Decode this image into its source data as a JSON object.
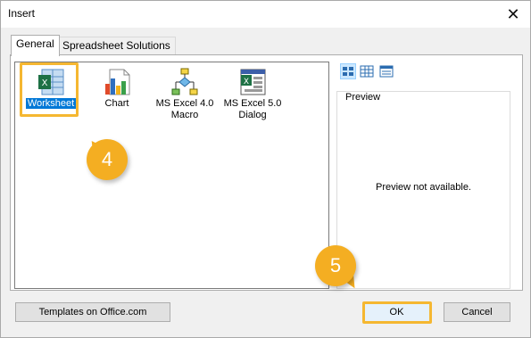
{
  "window": {
    "title": "Insert"
  },
  "tabs": [
    {
      "label": "General",
      "active": true
    },
    {
      "label": "Spreadsheet Solutions",
      "active": false
    }
  ],
  "items": [
    {
      "label": "Worksheet",
      "icon": "excel-worksheet-icon",
      "selected": true
    },
    {
      "label": "Chart",
      "icon": "chart-icon",
      "selected": false
    },
    {
      "label": "MS Excel 4.0 Macro",
      "icon": "macro-flowchart-icon",
      "selected": false
    },
    {
      "label": "MS Excel 5.0 Dialog",
      "icon": "dialog-sheet-icon",
      "selected": false
    }
  ],
  "view_buttons": [
    "large-icons-view-icon",
    "list-view-icon",
    "details-view-icon"
  ],
  "preview": {
    "label": "Preview",
    "message": "Preview not available."
  },
  "buttons": {
    "templates": "Templates on Office.com",
    "ok": "OK",
    "cancel": "Cancel"
  },
  "annotations": {
    "step4": "4",
    "step5": "5"
  },
  "colors": {
    "accent": "#0078d7",
    "callout": "#f4ae22",
    "highlight": "#f5b731",
    "excel_green": "#1e7145"
  }
}
